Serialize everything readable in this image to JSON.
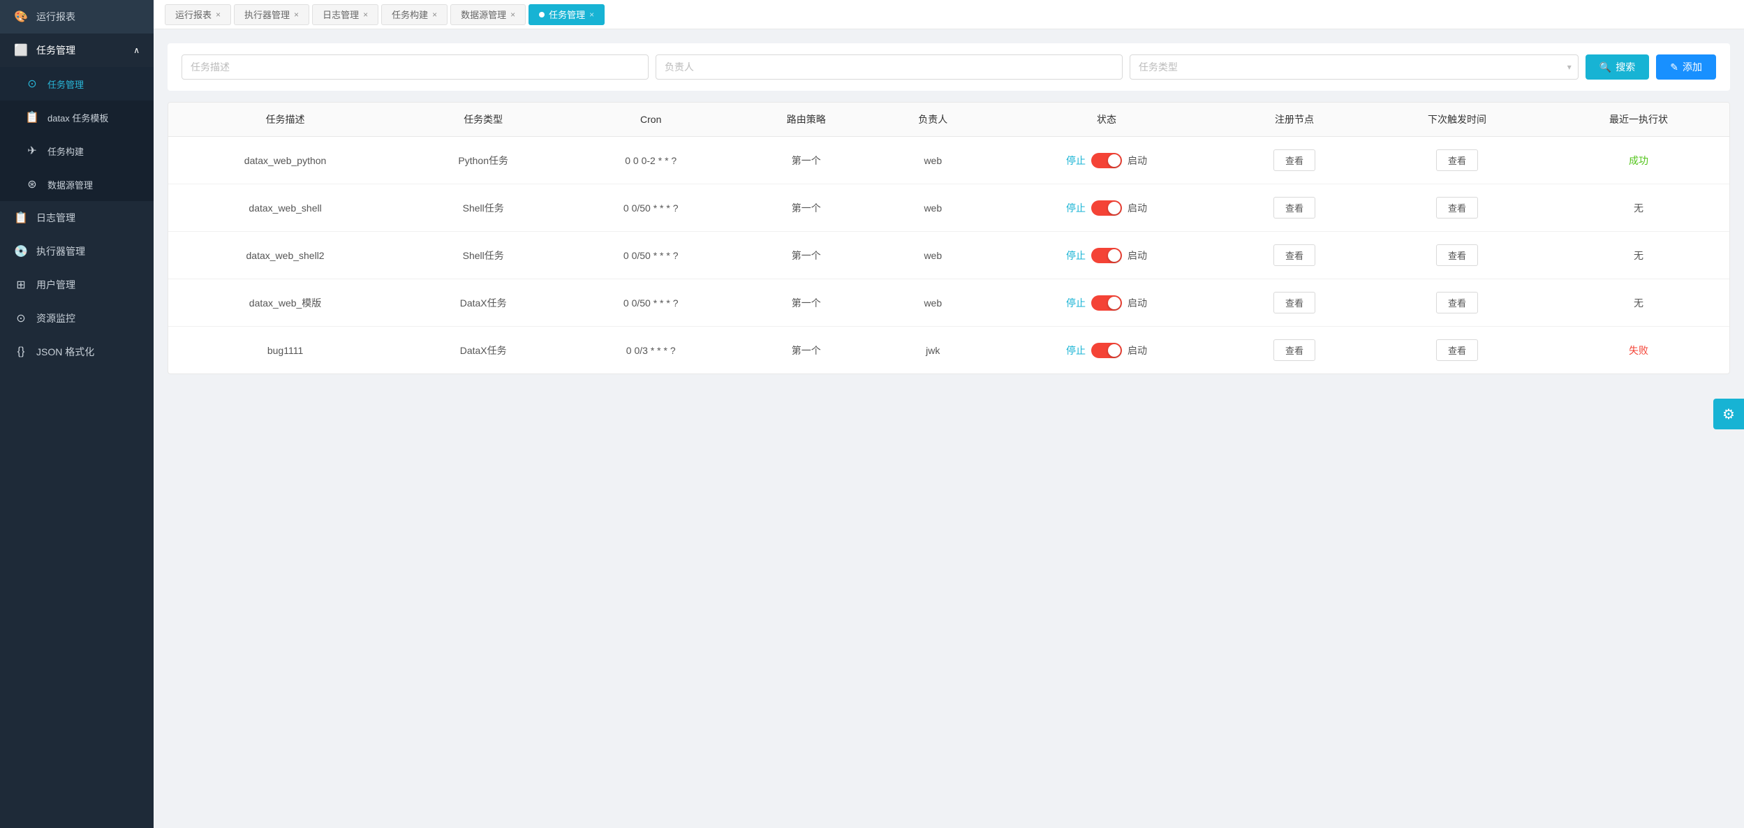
{
  "sidebar": {
    "items": [
      {
        "id": "report",
        "label": "运行报表",
        "icon": "🎨",
        "active": false
      },
      {
        "id": "task-mgmt",
        "label": "任务管理",
        "icon": "⬜",
        "active": true,
        "expanded": true,
        "children": [
          {
            "id": "task-manage",
            "label": "任务管理",
            "active": true
          },
          {
            "id": "datax-template",
            "label": "datax 任务模板",
            "active": false
          },
          {
            "id": "task-build",
            "label": "任务构建",
            "active": false
          },
          {
            "id": "datasource",
            "label": "数据源管理",
            "active": false
          }
        ]
      },
      {
        "id": "log-mgmt",
        "label": "日志管理",
        "icon": "📋",
        "active": false
      },
      {
        "id": "executor-mgmt",
        "label": "执行器管理",
        "icon": "💿",
        "active": false
      },
      {
        "id": "user-mgmt",
        "label": "用户管理",
        "icon": "⊞",
        "active": false
      },
      {
        "id": "resource-monitor",
        "label": "资源监控",
        "icon": "⊙",
        "active": false
      },
      {
        "id": "json-format",
        "label": "JSON 格式化",
        "icon": "{}",
        "active": false
      }
    ]
  },
  "tabs": [
    {
      "id": "report",
      "label": "运行报表",
      "active": false,
      "closable": true
    },
    {
      "id": "executor",
      "label": "执行器管理",
      "active": false,
      "closable": true
    },
    {
      "id": "log",
      "label": "日志管理",
      "active": false,
      "closable": true
    },
    {
      "id": "task-build",
      "label": "任务构建",
      "active": false,
      "closable": true
    },
    {
      "id": "datasource",
      "label": "数据源管理",
      "active": false,
      "closable": true
    },
    {
      "id": "task-mgmt",
      "label": "任务管理",
      "active": true,
      "closable": true
    }
  ],
  "search": {
    "task_desc_placeholder": "任务描述",
    "owner_placeholder": "负责人",
    "task_type_placeholder": "任务类型",
    "search_btn": "搜索",
    "add_btn": "添加"
  },
  "table": {
    "headers": [
      "任务描述",
      "任务类型",
      "Cron",
      "路由策略",
      "负责人",
      "状态",
      "注册节点",
      "下次触发时间",
      "最近一执行状"
    ],
    "rows": [
      {
        "desc": "datax_web_python",
        "type": "Python任务",
        "cron": "0 0 0-2 * * ?",
        "route": "第一个",
        "owner": "web",
        "status_stop": "停止",
        "status_start": "启动",
        "toggle_on": true,
        "reg_node": "查看",
        "next_trigger": "查看",
        "last_status": "成功"
      },
      {
        "desc": "datax_web_shell",
        "type": "Shell任务",
        "cron": "0 0/50 * * * ?",
        "route": "第一个",
        "owner": "web",
        "status_stop": "停止",
        "status_start": "启动",
        "toggle_on": true,
        "reg_node": "查看",
        "next_trigger": "查看",
        "last_status": "无"
      },
      {
        "desc": "datax_web_shell2",
        "type": "Shell任务",
        "cron": "0 0/50 * * * ?",
        "route": "第一个",
        "owner": "web",
        "status_stop": "停止",
        "status_start": "启动",
        "toggle_on": true,
        "reg_node": "查看",
        "next_trigger": "查看",
        "last_status": "无"
      },
      {
        "desc": "datax_web_模版",
        "type": "DataX任务",
        "cron": "0 0/50 * * * ?",
        "route": "第一个",
        "owner": "web",
        "status_stop": "停止",
        "status_start": "启动",
        "toggle_on": true,
        "reg_node": "查看",
        "next_trigger": "查看",
        "last_status": "无"
      },
      {
        "desc": "bug1111",
        "type": "DataX任务",
        "cron": "0 0/3 * * * ?",
        "route": "第一个",
        "owner": "jwk",
        "status_stop": "停止",
        "status_start": "启动",
        "toggle_on": true,
        "reg_node": "查看",
        "next_trigger": "查看",
        "last_status": "失败"
      }
    ]
  },
  "colors": {
    "sidebar_bg": "#1e2a38",
    "active_tab_bg": "#17b3d4",
    "search_btn_bg": "#17b3d4",
    "add_btn_bg": "#1890ff",
    "toggle_on_bg": "#f44336",
    "gear_bg": "#17b3d4"
  }
}
